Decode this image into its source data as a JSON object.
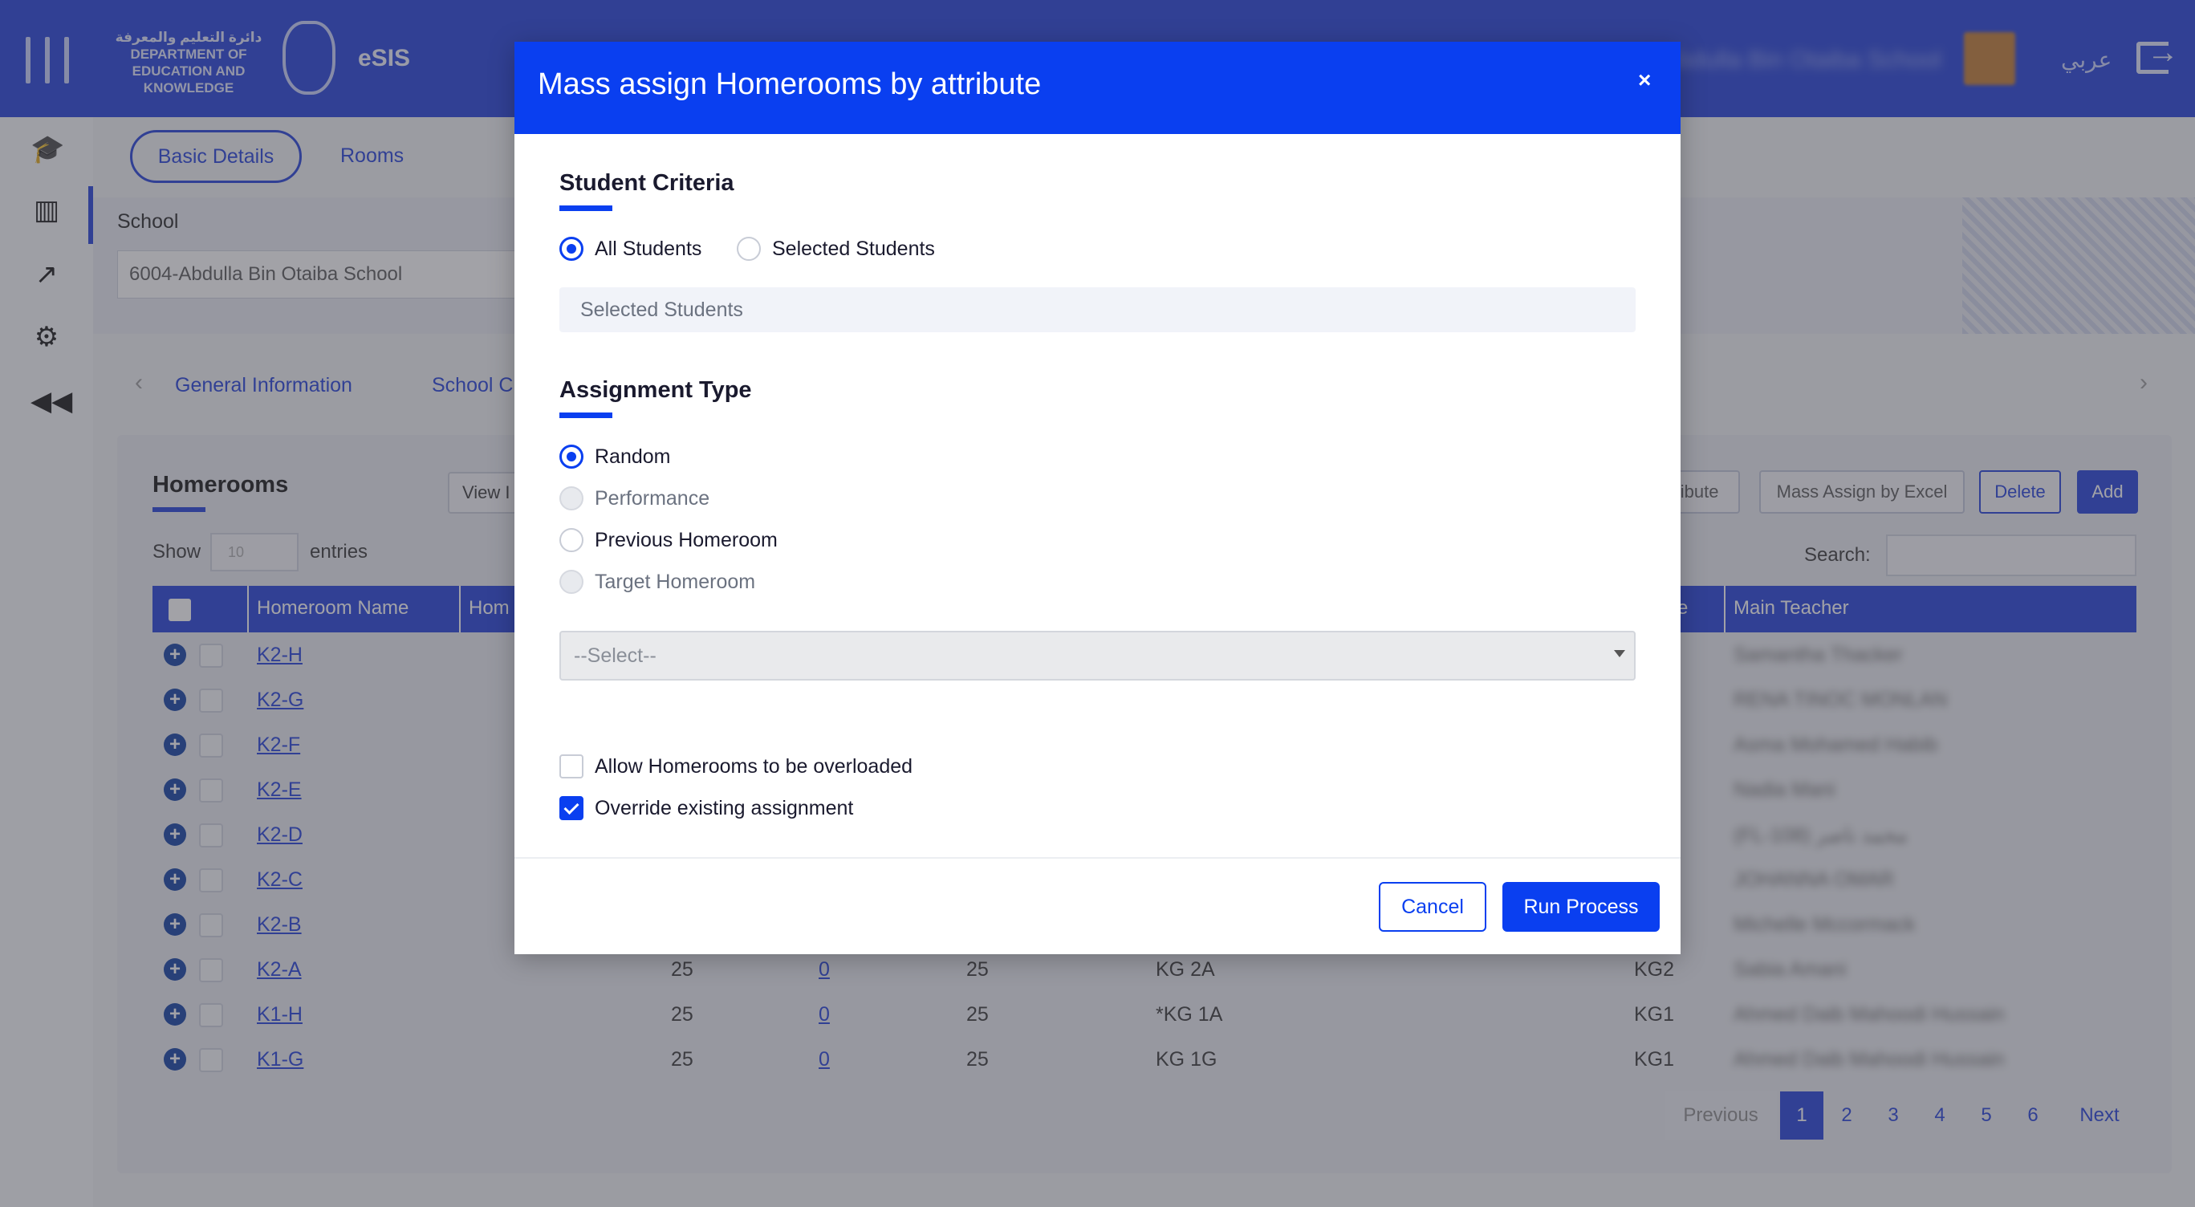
{
  "app": {
    "logo_text": "دائرة التعليم والمعرفة DEPARTMENT OF EDUCATION AND KNOWLEDGE",
    "name": "eSIS",
    "school_header": "Abdulla Bin Otaiba School",
    "lang_toggle": "عربي"
  },
  "tabs": {
    "basic_details": "Basic Details",
    "rooms": "Rooms"
  },
  "school": {
    "label": "School",
    "value": "6004-Abdulla Bin Otaiba School"
  },
  "subnav": {
    "general_information": "General Information",
    "school_c": "School C"
  },
  "homerooms_card": {
    "title": "Homerooms",
    "view_button": "View I",
    "attribute_button": "ribute",
    "mass_assign_excel": "Mass Assign by Excel",
    "delete_button": "Delete",
    "add_button": "Add",
    "show_label": "Show",
    "show_value": "10",
    "entries_label": "entries",
    "search_label": "Search:"
  },
  "table": {
    "headers": {
      "homeroom_name": "Homeroom Name",
      "hom": "Hom",
      "e": "e",
      "main_teacher": "Main Teacher"
    },
    "rows": [
      {
        "name": "K2-H",
        "teacher": "Samantha Thacker"
      },
      {
        "name": "K2-G",
        "teacher": "RENA TINOC MONLAN"
      },
      {
        "name": "K2-F",
        "teacher": "Asma Mohamed Habib"
      },
      {
        "name": "K2-E",
        "teacher": "Nadia Mani"
      },
      {
        "name": "K2-D",
        "teacher": "(FL-108) محمد ناصر"
      },
      {
        "name": "K2-C",
        "teacher": "JOHANNA OMAR"
      },
      {
        "name": "K2-B",
        "teacher": "Michelle Mccormack"
      },
      {
        "name": "K2-A",
        "c1": "25",
        "c2": "0",
        "c3": "25",
        "c4": "KG 2A",
        "c5": "KG2",
        "teacher": "Sabia Amani"
      },
      {
        "name": "K1-H",
        "c1": "25",
        "c2": "0",
        "c3": "25",
        "c4": "*KG 1A",
        "c5": "KG1",
        "teacher": "Ahmed Daib Mahoodi Hussain"
      },
      {
        "name": "K1-G",
        "c1": "25",
        "c2": "0",
        "c3": "25",
        "c4": "KG 1G",
        "c5": "KG1",
        "teacher": "Ahmed Daib Mahoodi Hussain"
      }
    ]
  },
  "pagination": {
    "previous": "Previous",
    "pages": [
      "1",
      "2",
      "3",
      "4",
      "5",
      "6"
    ],
    "next": "Next",
    "active": "1"
  },
  "modal": {
    "title": "Mass assign Homerooms by attribute",
    "close": "×",
    "student_criteria": {
      "title": "Student Criteria",
      "all_students": "All Students",
      "selected_students": "Selected Students",
      "selected_students_field": "Selected Students",
      "selected": "All Students"
    },
    "assignment_type": {
      "title": "Assignment Type",
      "random": "Random",
      "performance": "Performance",
      "previous_homeroom": "Previous Homeroom",
      "target_homeroom": "Target Homeroom",
      "selected": "Random",
      "select_placeholder": "--Select--"
    },
    "options": {
      "allow_overloaded": "Allow Homerooms to be overloaded",
      "allow_overloaded_checked": false,
      "override_existing": "Override existing assignment",
      "override_existing_checked": true
    },
    "cancel": "Cancel",
    "run_process": "Run Process"
  }
}
